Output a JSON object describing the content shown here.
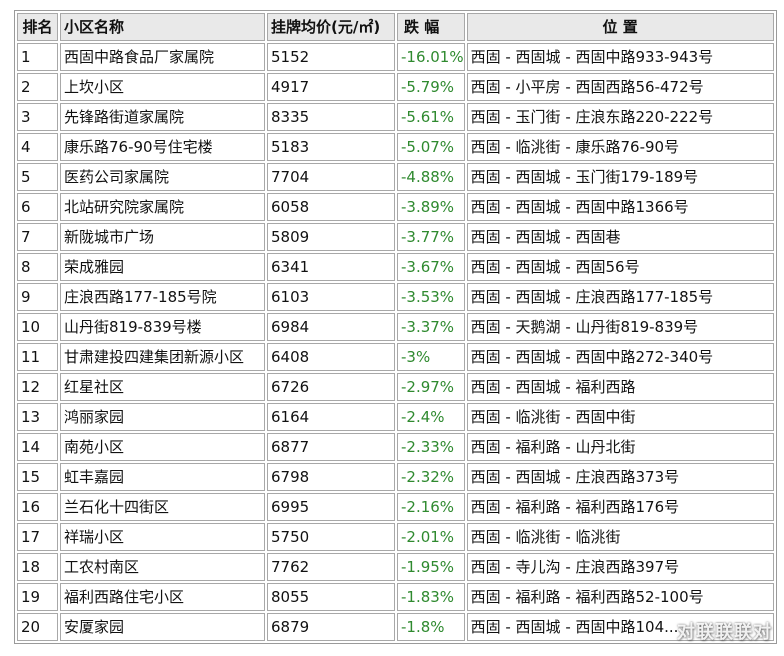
{
  "table": {
    "headers": {
      "rank": "排名",
      "name": "小区名称",
      "price": "挂牌均价(元/㎡)",
      "change": "跌 幅",
      "location": "位 置"
    },
    "rows": [
      {
        "rank": "1",
        "name": "西固中路食品厂家属院",
        "price": "5152",
        "change": "-16.01%",
        "location": "西固 - 西固城 - 西固中路933-943号"
      },
      {
        "rank": "2",
        "name": "上坎小区",
        "price": "4917",
        "change": "-5.79%",
        "location": "西固 - 小平房 - 西固西路56-472号"
      },
      {
        "rank": "3",
        "name": "先锋路街道家属院",
        "price": "8335",
        "change": "-5.61%",
        "location": "西固 - 玉门街 - 庄浪东路220-222号"
      },
      {
        "rank": "4",
        "name": "康乐路76-90号住宅楼",
        "price": "5183",
        "change": "-5.07%",
        "location": "西固 - 临洮街 - 康乐路76-90号"
      },
      {
        "rank": "5",
        "name": "医药公司家属院",
        "price": "7704",
        "change": "-4.88%",
        "location": "西固 - 西固城 - 玉门街179-189号"
      },
      {
        "rank": "6",
        "name": "北站研究院家属院",
        "price": "6058",
        "change": "-3.89%",
        "location": "西固 - 西固城 - 西固中路1366号"
      },
      {
        "rank": "7",
        "name": "新陇城市广场",
        "price": "5809",
        "change": "-3.77%",
        "location": "西固 - 西固城 - 西固巷"
      },
      {
        "rank": "8",
        "name": "荣成雅园",
        "price": "6341",
        "change": "-3.67%",
        "location": "西固 - 西固城 - 西固56号"
      },
      {
        "rank": "9",
        "name": "庄浪西路177-185号院",
        "price": "6103",
        "change": "-3.53%",
        "location": "西固 - 西固城 - 庄浪西路177-185号"
      },
      {
        "rank": "10",
        "name": "山丹街819-839号楼",
        "price": "6984",
        "change": "-3.37%",
        "location": "西固 - 天鹅湖 - 山丹街819-839号"
      },
      {
        "rank": "11",
        "name": "甘肃建投四建集团新源小区",
        "price": "6408",
        "change": "-3%",
        "location": "西固 - 西固城 - 西固中路272-340号"
      },
      {
        "rank": "12",
        "name": "红星社区",
        "price": "6726",
        "change": "-2.97%",
        "location": "西固 - 西固城 - 福利西路"
      },
      {
        "rank": "13",
        "name": "鸿丽家园",
        "price": "6164",
        "change": "-2.4%",
        "location": "西固 - 临洮街 - 西固中街"
      },
      {
        "rank": "14",
        "name": "南苑小区",
        "price": "6877",
        "change": "-2.33%",
        "location": "西固 - 福利路 - 山丹北街"
      },
      {
        "rank": "15",
        "name": "虹丰嘉园",
        "price": "6798",
        "change": "-2.32%",
        "location": "西固 - 西固城 - 庄浪西路373号"
      },
      {
        "rank": "16",
        "name": "兰石化十四街区",
        "price": "6995",
        "change": "-2.16%",
        "location": "西固 - 福利路 - 福利西路176号"
      },
      {
        "rank": "17",
        "name": "祥瑞小区",
        "price": "5750",
        "change": "-2.01%",
        "location": "西固 - 临洮街 - 临洮街"
      },
      {
        "rank": "18",
        "name": "工农村南区",
        "price": "7762",
        "change": "-1.95%",
        "location": "西固 - 寺儿沟 - 庄浪西路397号"
      },
      {
        "rank": "19",
        "name": "福利西路住宅小区",
        "price": "8055",
        "change": "-1.83%",
        "location": "西固 - 福利路 - 福利西路52-100号"
      },
      {
        "rank": "20",
        "name": "安厦家园",
        "price": "6879",
        "change": "-1.8%",
        "location": "西固 - 西固城 - 西固中路104..."
      }
    ]
  },
  "colors": {
    "change_text": "#2f8a2f",
    "header_bg": "#e9e9e9",
    "border": "#a8a8a8"
  },
  "watermark": "对联联联对"
}
